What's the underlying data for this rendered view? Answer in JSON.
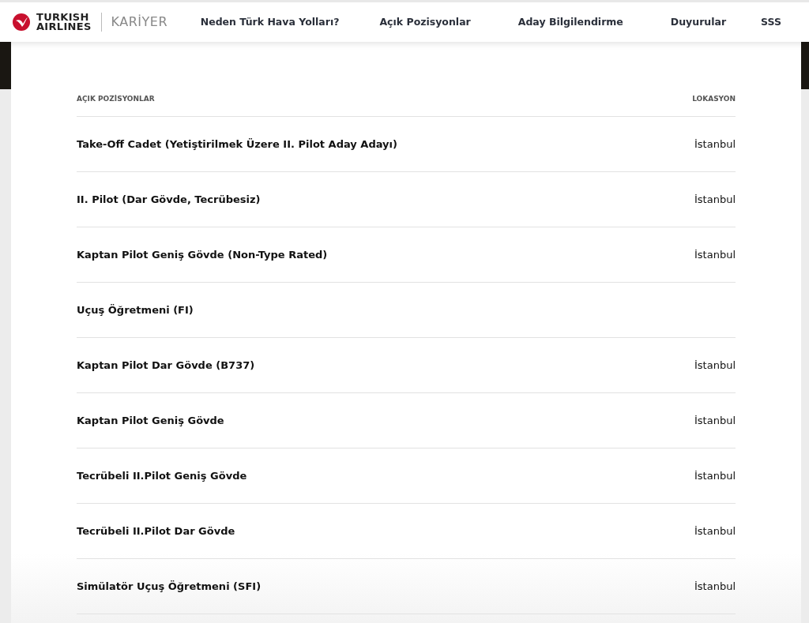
{
  "header": {
    "logo_text": [
      "TURKISH",
      "AIRLINES"
    ],
    "section": "KARİYER",
    "nav": [
      {
        "label": "Neden Türk Hava Yolları?"
      },
      {
        "label": "Açık Pozisyonlar"
      },
      {
        "label": "Aday Bilgilendirme"
      },
      {
        "label": "Duyurular"
      },
      {
        "label": "SSS"
      }
    ]
  },
  "table": {
    "columns": [
      "AÇIK POZİSYONLAR",
      "LOKASYON"
    ],
    "rows": [
      {
        "title": "Take-Off Cadet (Yetiştirilmek Üzere II. Pilot Aday Adayı)",
        "location": "İstanbul"
      },
      {
        "title": "II. Pilot (Dar Gövde, Tecrübesiz)",
        "location": "İstanbul"
      },
      {
        "title": "Kaptan Pilot Geniş Gövde (Non-Type Rated)",
        "location": "İstanbul"
      },
      {
        "title": "Uçuş Öğretmeni (FI)"
      },
      {
        "title": "Kaptan Pilot Dar Gövde (B737)",
        "location": "İstanbul"
      },
      {
        "title": "Kaptan Pilot Geniş Gövde",
        "location": "İstanbul"
      },
      {
        "title": "Tecrübeli II.Pilot Geniş Gövde",
        "location": "İstanbul"
      },
      {
        "title": "Tecrübeli II.Pilot Dar Gövde",
        "location": "İstanbul"
      },
      {
        "title": "Simülatör Uçuş Öğretmeni (SFI)",
        "location": "İstanbul"
      }
    ]
  }
}
